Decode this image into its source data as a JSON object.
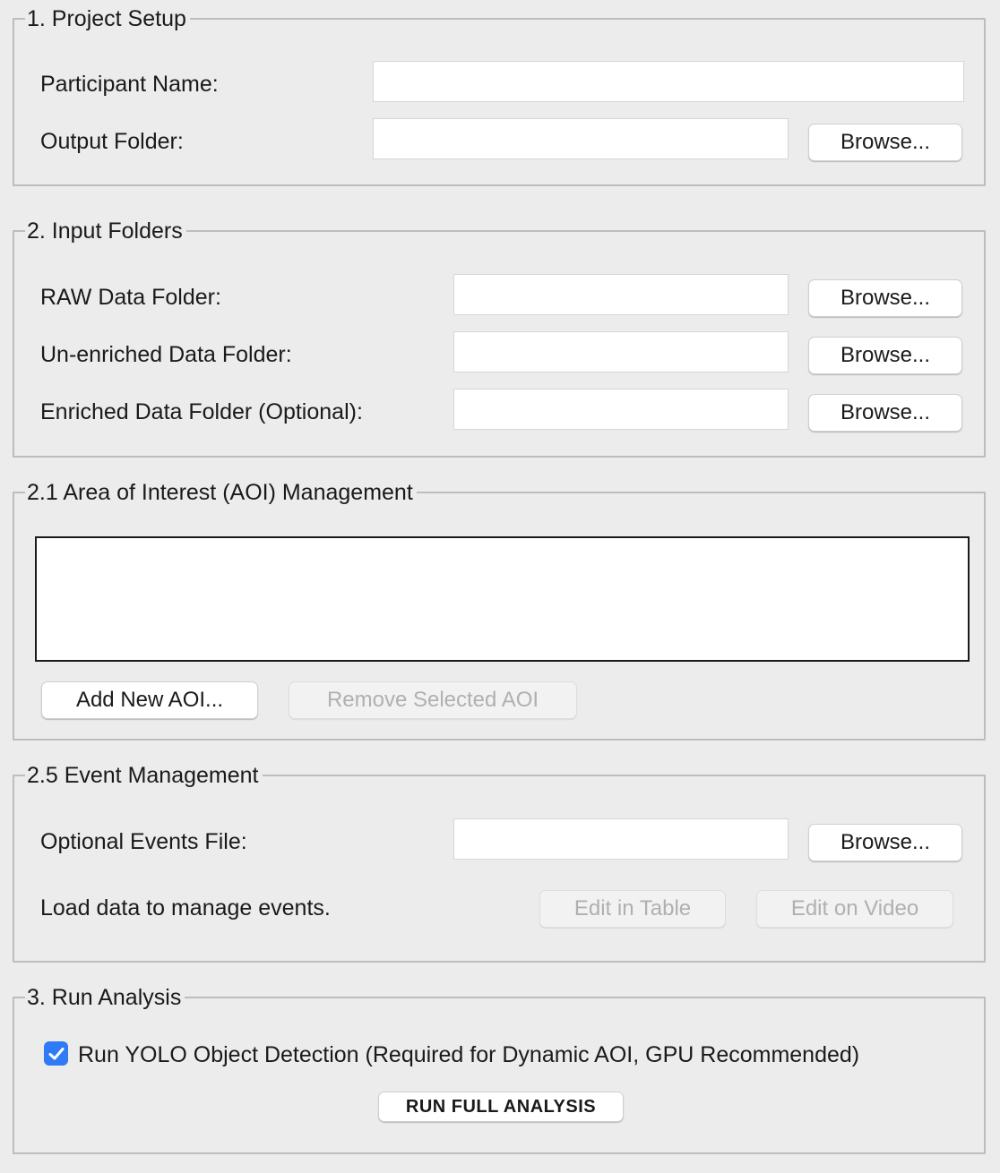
{
  "project_setup": {
    "title": "1. Project Setup",
    "participant_label": "Participant Name:",
    "participant_value": "",
    "output_label": "Output Folder:",
    "output_value": "",
    "browse_label": "Browse..."
  },
  "input_folders": {
    "title": "2. Input Folders",
    "raw_label": "RAW Data Folder:",
    "raw_value": "",
    "unenriched_label": "Un-enriched Data Folder:",
    "unenriched_value": "",
    "enriched_label": "Enriched Data Folder (Optional):",
    "enriched_value": "",
    "browse_label": "Browse..."
  },
  "aoi": {
    "title": "2.1 Area of Interest (AOI) Management",
    "items": [],
    "add_label": "Add New AOI...",
    "remove_label": "Remove Selected AOI",
    "remove_enabled": false
  },
  "events": {
    "title": "2.5 Event Management",
    "file_label": "Optional Events File:",
    "file_value": "",
    "browse_label": "Browse...",
    "status_text": "Load data to manage events.",
    "edit_table_label": "Edit in Table",
    "edit_video_label": "Edit on Video",
    "edit_enabled": false
  },
  "run": {
    "title": "3. Run Analysis",
    "yolo_label": "Run YOLO Object Detection (Required for Dynamic AOI, GPU Recommended)",
    "yolo_checked": true,
    "run_label": "RUN FULL ANALYSIS"
  },
  "colors": {
    "background": "#ececec",
    "accent": "#2f7bf5",
    "disabled_text": "#b0b0b0"
  }
}
